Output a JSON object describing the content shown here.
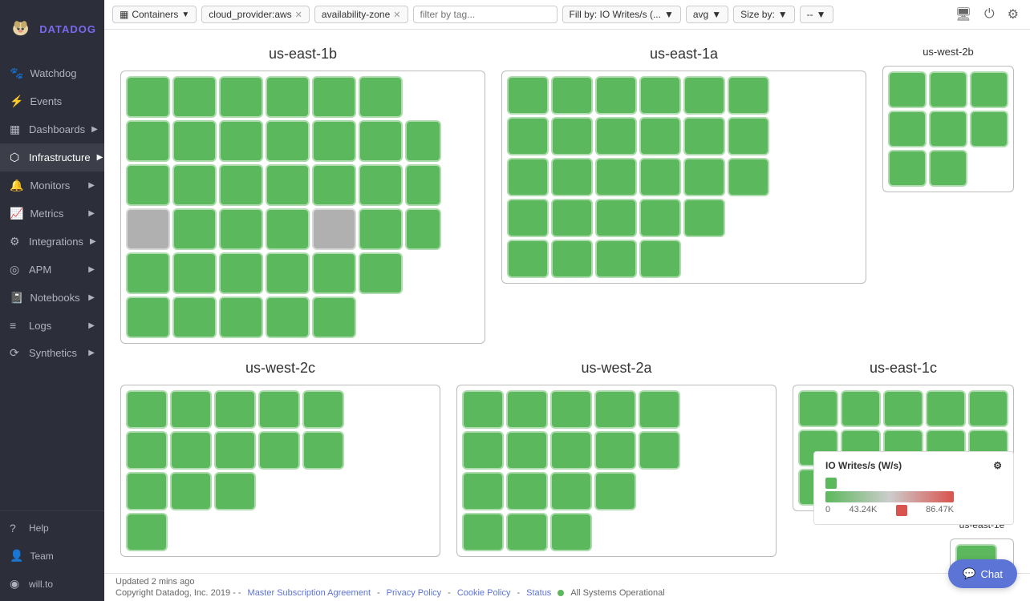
{
  "sidebar": {
    "logo_text": "DATADOG",
    "items": [
      {
        "label": "Watchdog",
        "icon": "🐾",
        "has_arrow": false
      },
      {
        "label": "Events",
        "icon": "⚡",
        "has_arrow": false
      },
      {
        "label": "Dashboards",
        "icon": "▦",
        "has_arrow": true
      },
      {
        "label": "Infrastructure",
        "icon": "🖧",
        "has_arrow": true
      },
      {
        "label": "Monitors",
        "icon": "🔔",
        "has_arrow": true
      },
      {
        "label": "Metrics",
        "icon": "📈",
        "has_arrow": true
      },
      {
        "label": "Integrations",
        "icon": "🔌",
        "has_arrow": true
      },
      {
        "label": "APM",
        "icon": "◎",
        "has_arrow": true
      },
      {
        "label": "Notebooks",
        "icon": "📓",
        "has_arrow": true
      },
      {
        "label": "Logs",
        "icon": "≡",
        "has_arrow": true
      },
      {
        "label": "Synthetics",
        "icon": "⟳",
        "has_arrow": true
      }
    ],
    "bottom_items": [
      {
        "label": "Help",
        "icon": "?"
      },
      {
        "label": "Team",
        "icon": "👤"
      },
      {
        "label": "will.to",
        "icon": "◉"
      }
    ]
  },
  "toolbar": {
    "view_label": "Containers",
    "filters": [
      {
        "text": "cloud_provider:aws",
        "removable": true
      },
      {
        "text": "availability-zone",
        "removable": true
      }
    ],
    "fill_label": "Fill by: IO Writes/s (...",
    "fill_agg": "avg",
    "size_label": "Size by:",
    "size_value": "--"
  },
  "regions": [
    {
      "id": "us-east-1b",
      "title": "us-east-1b",
      "size": "large"
    },
    {
      "id": "us-east-1a",
      "title": "us-east-1a",
      "size": "large"
    },
    {
      "id": "us-west-2b",
      "title": "us-west-2b",
      "size": "small"
    },
    {
      "id": "us-west-2c",
      "title": "us-west-2c",
      "size": "medium"
    },
    {
      "id": "us-west-2a",
      "title": "us-west-2a",
      "size": "medium"
    },
    {
      "id": "us-east-1c",
      "title": "us-east-1c",
      "size": "medium"
    },
    {
      "id": "us-east-1e",
      "title": "us-east-1e",
      "size": "tiny"
    }
  ],
  "legend": {
    "title": "IO Writes/s (W/s)",
    "min": "0",
    "mid": "43.24K",
    "max": "86.47K"
  },
  "footer": {
    "updated_text": "Updated 2 mins ago",
    "copyright": "Copyright Datadog, Inc. 2019 - -",
    "links": [
      "Master Subscription Agreement",
      "Privacy Policy",
      "Cookie Policy",
      "Status"
    ],
    "status_text": "All Systems Operational"
  },
  "chat": {
    "label": "Chat"
  }
}
